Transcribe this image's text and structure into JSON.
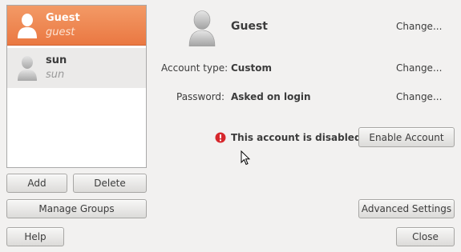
{
  "users": [
    {
      "name": "Guest",
      "login": "guest"
    },
    {
      "name": "sun",
      "login": "sun"
    }
  ],
  "buttons": {
    "add": "Add",
    "delete": "Delete",
    "manage_groups": "Manage Groups",
    "help": "Help",
    "enable_account": "Enable Account",
    "advanced_settings": "Advanced Settings",
    "close": "Close"
  },
  "details": {
    "name": "Guest",
    "change_name": "Change...",
    "account_type_label": "Account type:",
    "account_type_value": "Custom",
    "change_account_type": "Change...",
    "password_label": "Password:",
    "password_value": "Asked on login",
    "change_password": "Change...",
    "disabled_message": "This account is disabled."
  },
  "colors": {
    "selection": "#ea7842",
    "error_icon": "#d6272c"
  },
  "icons": {
    "user": "user-silhouette-icon",
    "error": "error-icon",
    "cursor": "mouse-pointer-icon"
  }
}
